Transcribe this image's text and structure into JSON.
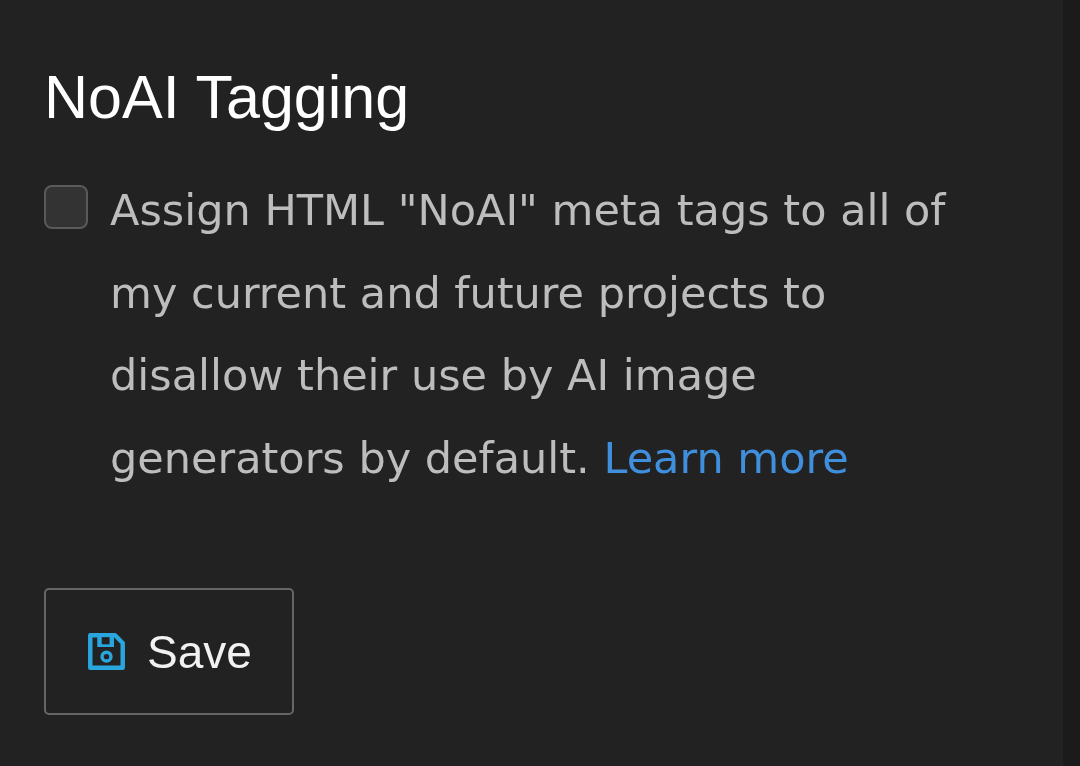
{
  "section": {
    "title": "NoAI Tagging"
  },
  "option": {
    "checked": false,
    "label": "Assign HTML \"NoAI\" meta tags to all of my current and future projects to disallow their use by AI image generators by default.",
    "link": "Learn more"
  },
  "buttons": [
    {
      "label": "Save",
      "kind": "save"
    }
  ]
}
